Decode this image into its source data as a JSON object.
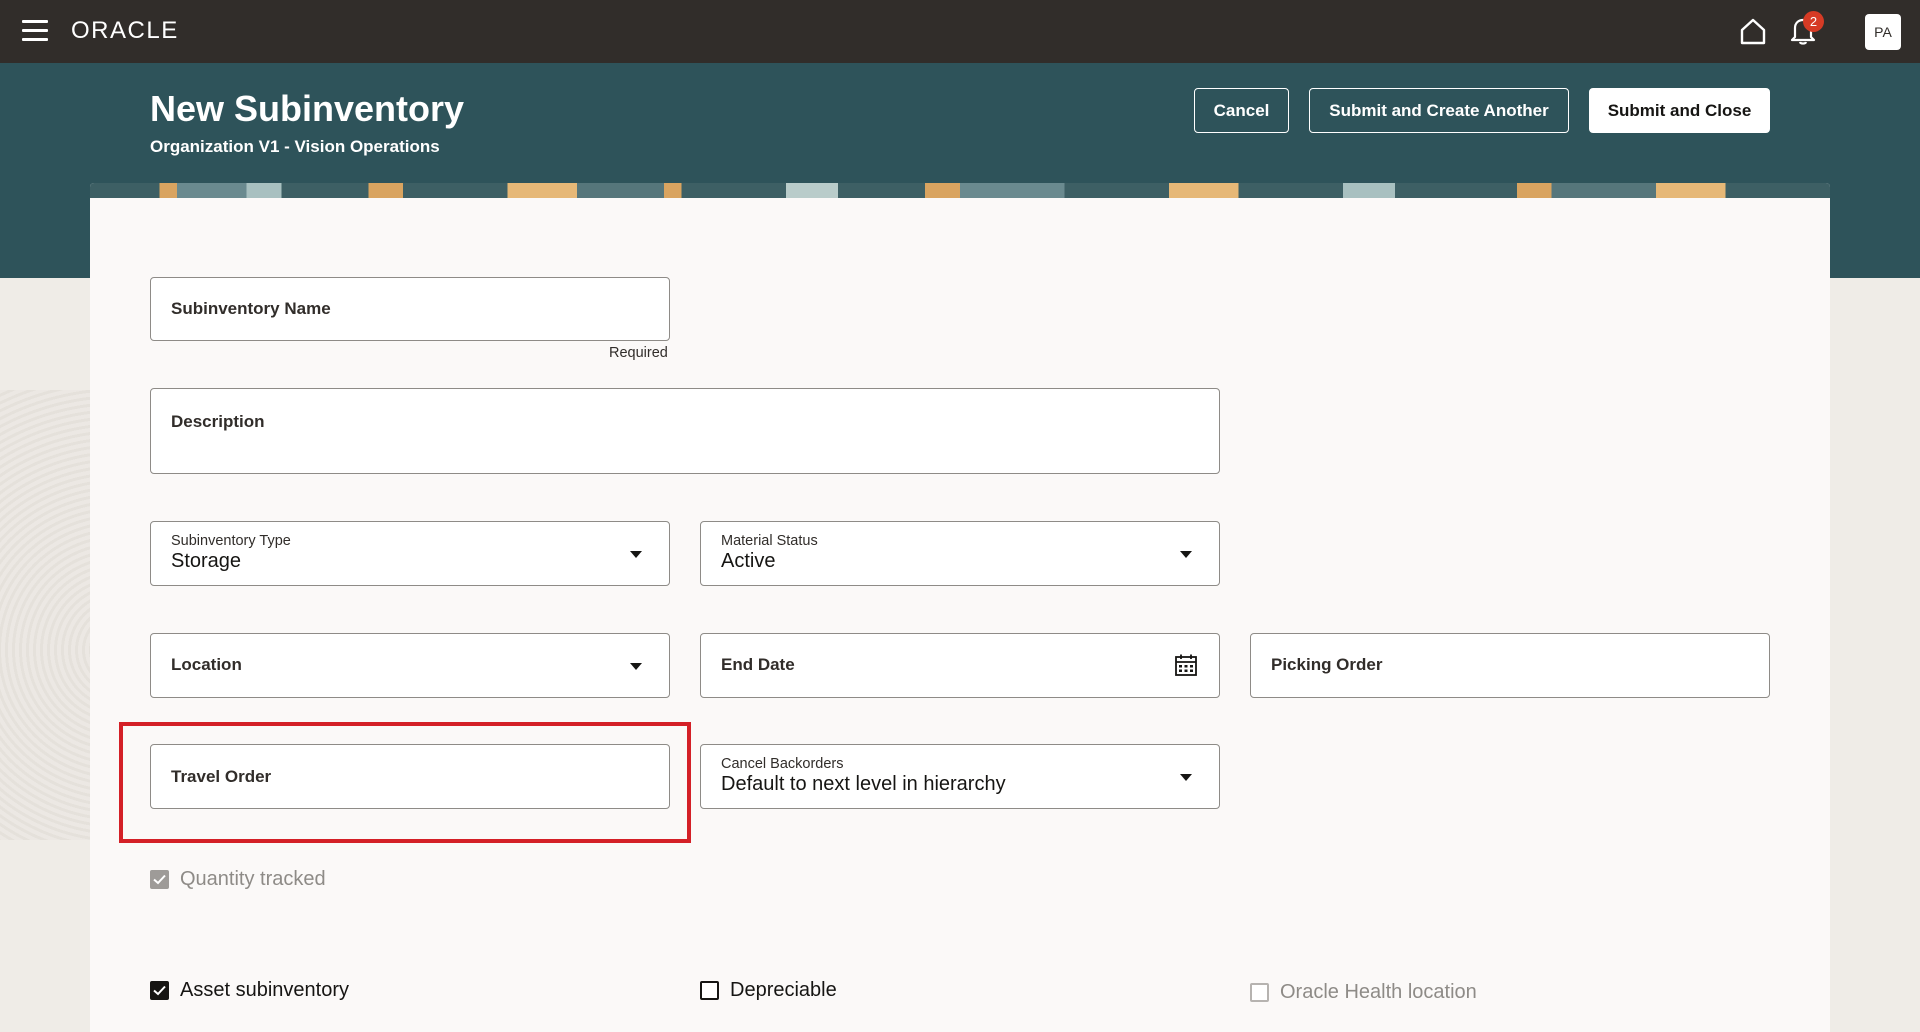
{
  "topbar": {
    "brand": "ORACLE",
    "notification_count": "2",
    "user_initials": "PA"
  },
  "header": {
    "title": "New Subinventory",
    "subtitle": "Organization V1 - Vision Operations",
    "cancel_label": "Cancel",
    "submit_create_label": "Submit and Create Another",
    "submit_close_label": "Submit and Close"
  },
  "form": {
    "subinventory_name": {
      "label": "Subinventory Name",
      "value": "",
      "helper": "Required"
    },
    "description": {
      "label": "Description",
      "value": ""
    },
    "subinventory_type": {
      "label": "Subinventory Type",
      "value": "Storage"
    },
    "material_status": {
      "label": "Material Status",
      "value": "Active"
    },
    "location": {
      "label": "Location",
      "value": ""
    },
    "end_date": {
      "label": "End Date",
      "value": ""
    },
    "picking_order": {
      "label": "Picking Order",
      "value": ""
    },
    "travel_order": {
      "label": "Travel Order",
      "value": ""
    },
    "cancel_backorders": {
      "label": "Cancel Backorders",
      "value": "Default to next level in hierarchy"
    },
    "quantity_tracked": {
      "label": "Quantity tracked",
      "checked": true,
      "disabled": true
    },
    "asset_subinventory": {
      "label": "Asset subinventory",
      "checked": true
    },
    "depreciable": {
      "label": "Depreciable",
      "checked": false
    },
    "oracle_health_location": {
      "label": "Oracle Health location",
      "checked": false,
      "disabled": true
    }
  },
  "colors": {
    "topbar": "#312d2a",
    "header_band": "#2e535a",
    "highlight": "#d42027"
  }
}
